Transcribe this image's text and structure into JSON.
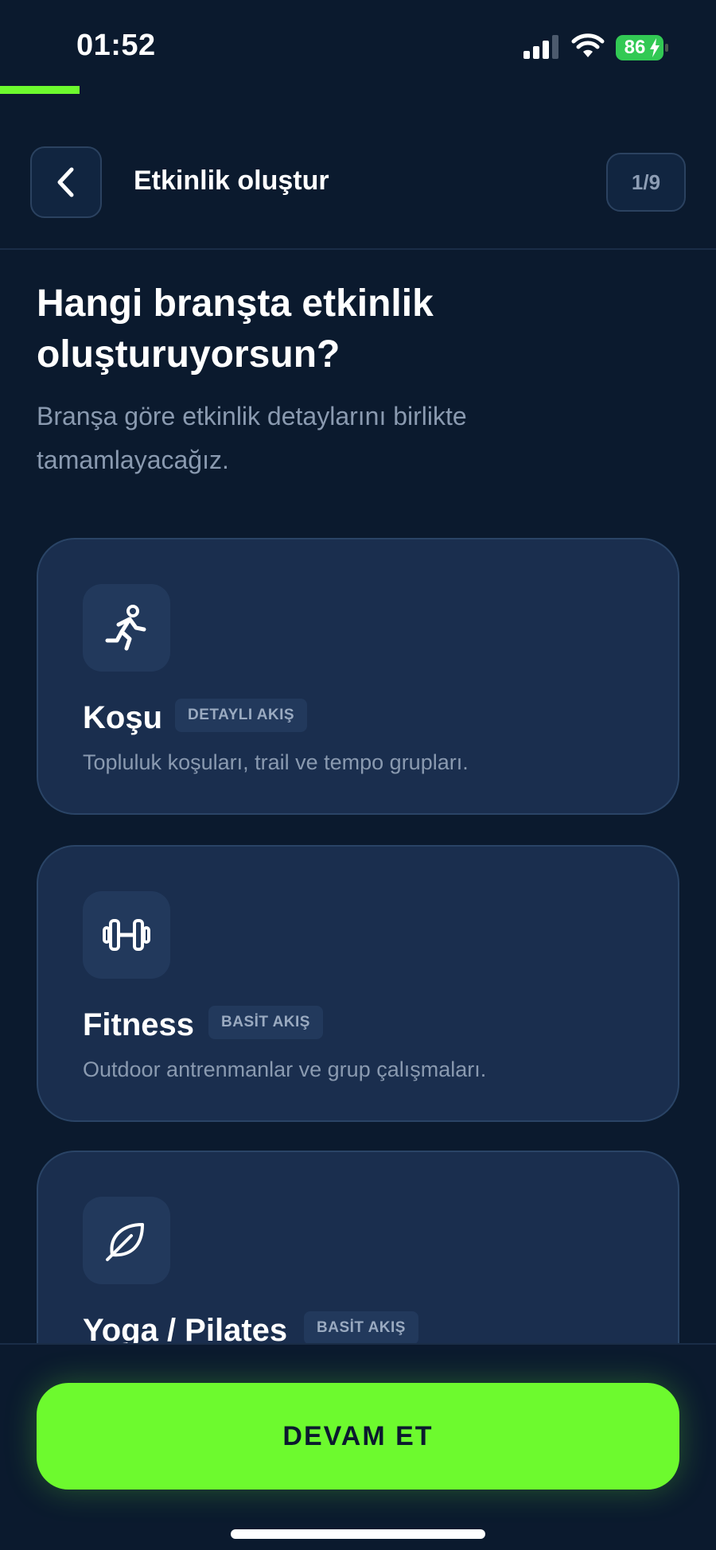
{
  "status_bar": {
    "time": "01:52",
    "battery_percent": "86",
    "battery_color": "#32c954"
  },
  "progress": {
    "current_step": 1,
    "total_steps": 9,
    "accent_color": "#6dfa2e"
  },
  "header": {
    "back_icon": "chevron-left-icon",
    "title": "Etkinlik oluştur",
    "step_label": "1/9"
  },
  "content": {
    "heading": "Hangi branşta etkinlik oluşturuyorsun?",
    "subtitle": "Branşa göre etkinlik detaylarını birlikte tamamlayacağız."
  },
  "sports": [
    {
      "icon": "running-person-icon",
      "title": "Koşu",
      "tag": "DETAYLI AKIŞ",
      "description": "Topluluk koşuları, trail ve tempo grupları."
    },
    {
      "icon": "dumbbell-icon",
      "title": "Fitness",
      "tag": "BASİT AKIŞ",
      "description": "Outdoor antrenmanlar ve grup çalışmaları."
    },
    {
      "icon": "leaf-icon",
      "title": "Yoga / Pilates",
      "tag": "BASİT AKIŞ",
      "description": ""
    }
  ],
  "footer": {
    "continue_label": "DEVAM ET"
  }
}
